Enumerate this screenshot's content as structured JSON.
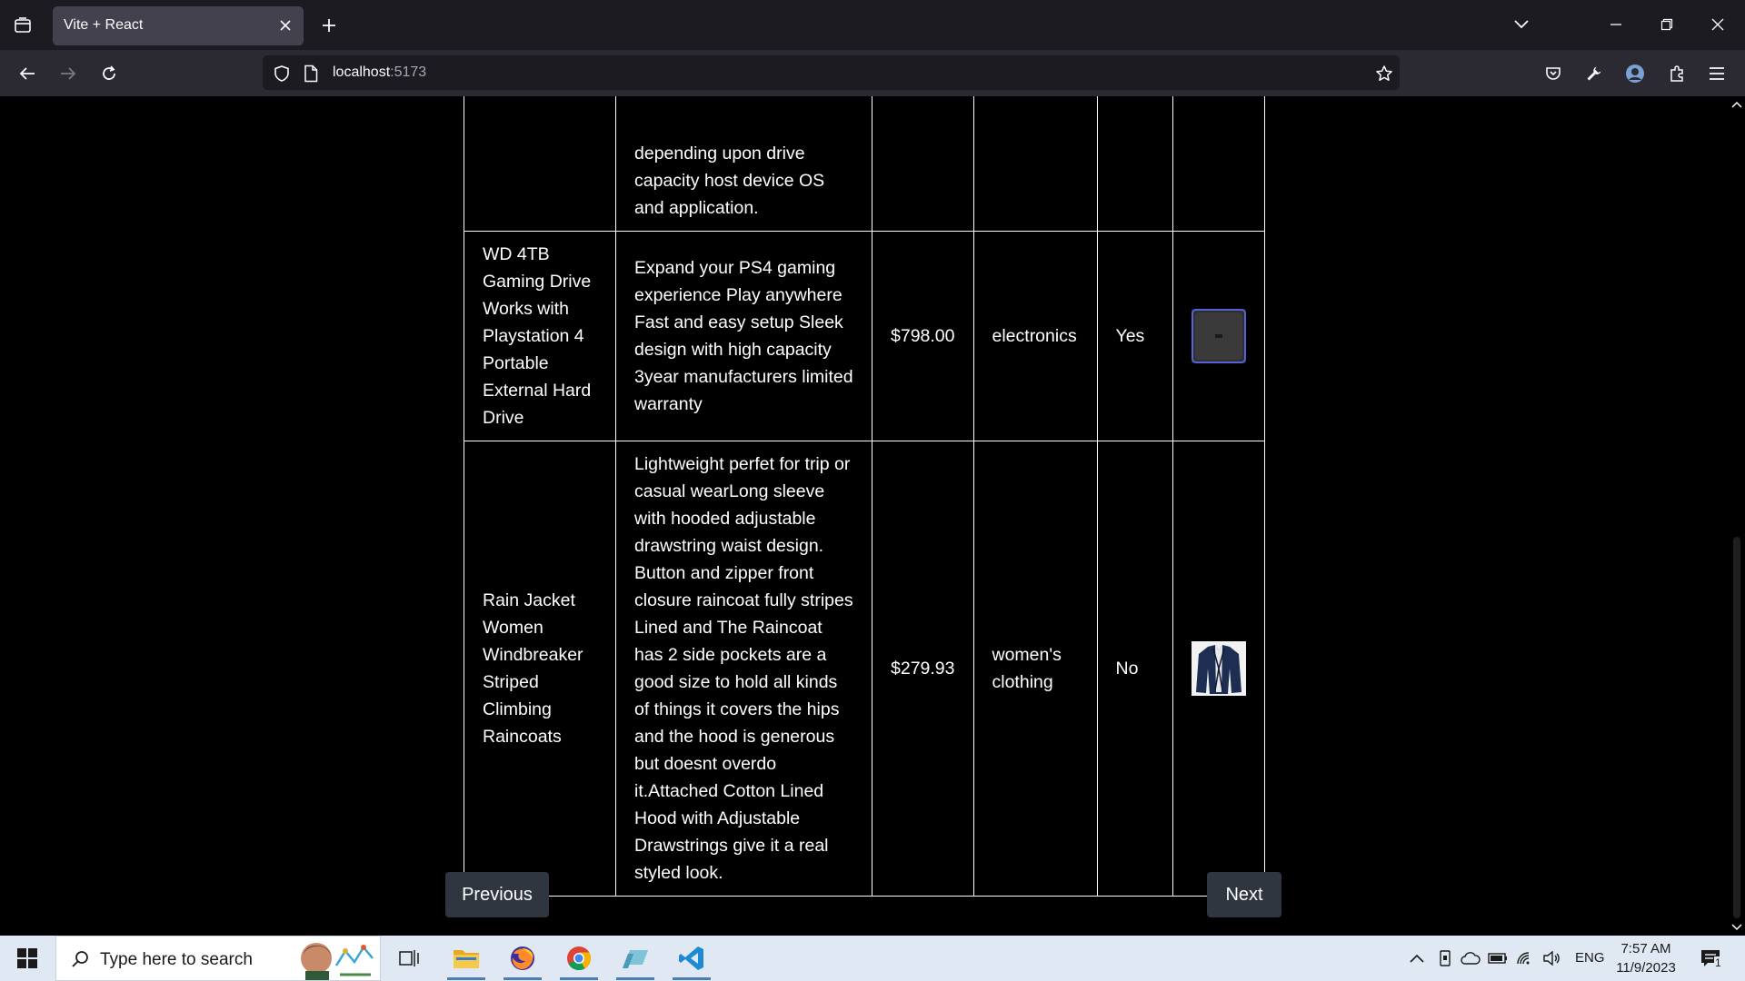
{
  "browser": {
    "tab_title": "Vite + React",
    "url_host": "localhost",
    "url_port": ":5173"
  },
  "table": {
    "partial_row_desc_lines": [
      "depending upon drive",
      "capacity host device OS",
      "and application."
    ],
    "rows": [
      {
        "title": "WD 4TB Gaming Drive Works with Playstation 4 Portable External Hard Drive",
        "description": "Expand your PS4 gaming experience Play anywhere Fast and easy setup Sleek design with high capacity 3year manufacturers limited warranty",
        "price": "$798.00",
        "category": "electronics",
        "rating": "Yes",
        "image": "hard-drive"
      },
      {
        "title": "Rain Jacket Women Windbreaker Striped Climbing Raincoats",
        "description": "Lightweight perfet for trip or casual wearLong sleeve with hooded adjustable drawstring waist design. Button and zipper front closure raincoat fully stripes Lined and The Raincoat has 2 side pockets are a good size to hold all kinds of things it covers the hips and the hood is generous but doesnt overdo it.Attached Cotton Lined Hood with Adjustable Drawstrings give it a real styled look.",
        "price": "$279.93",
        "category": "women's clothing",
        "rating": "No",
        "image": "jacket"
      }
    ]
  },
  "pagination": {
    "previous_label": "Previous",
    "next_label": "Next"
  },
  "taskbar": {
    "search_placeholder": "Type here to search",
    "language": "ENG",
    "time": "7:57 AM",
    "date": "11/9/2023",
    "notification_count": "1"
  }
}
